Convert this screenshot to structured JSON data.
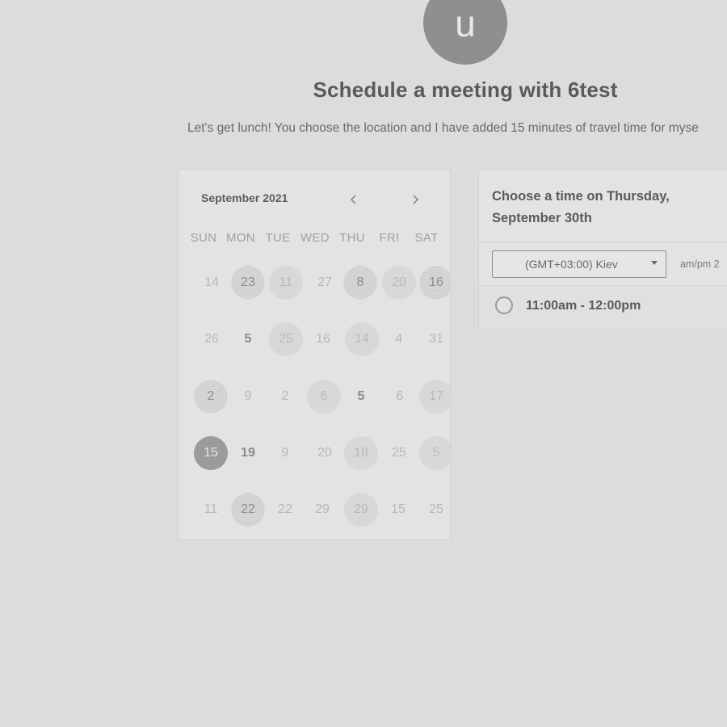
{
  "header": {
    "avatar_letter": "u",
    "title": "Schedule a meeting with 6test",
    "description": "Let's get lunch! You choose the location and I have added 15 minutes of travel time for myse"
  },
  "calendar": {
    "month_label": "September 2021",
    "prev_icon": "chevron-left-icon",
    "next_icon": "chevron-right-icon",
    "weekdays": [
      "SUN",
      "MON",
      "TUE",
      "WED",
      "THU",
      "FRI",
      "SAT"
    ],
    "weeks": [
      [
        "14",
        "23",
        "11",
        "27",
        "8",
        "20",
        "16"
      ],
      [
        "26",
        "5",
        "25",
        "16",
        "14",
        "4",
        "31"
      ],
      [
        "2",
        "9",
        "2",
        "6",
        "5",
        "6",
        "17"
      ],
      [
        "15",
        "19",
        "9",
        "20",
        "18",
        "25",
        "5"
      ],
      [
        "11",
        "22",
        "22",
        "29",
        "29",
        "15",
        "25"
      ]
    ]
  },
  "time_panel": {
    "heading_line1": "Choose a time on Thursday,",
    "heading_line2": "September 30th",
    "timezone_value": "(GMT+03:00) Kiev",
    "format_label": "am/pm  2",
    "slots": [
      {
        "label": "11:00am - 12:00pm"
      }
    ]
  }
}
